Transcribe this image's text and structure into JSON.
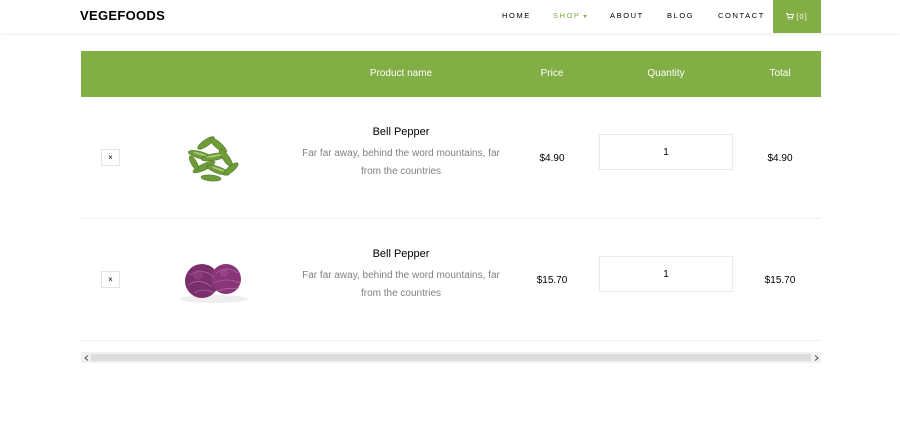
{
  "brand": "VEGEFOODS",
  "nav": {
    "items": [
      "HOME",
      "SHOP",
      "ABOUT",
      "BLOG",
      "CONTACT"
    ],
    "active": "SHOP",
    "cart_label": "[0]",
    "accent": "#82ae46"
  },
  "table": {
    "headers": {
      "product_name": "Product name",
      "price": "Price",
      "quantity": "Quantity",
      "total": "Total"
    },
    "rows": [
      {
        "remove": "×",
        "image": "green-peas",
        "name": "Bell Pepper",
        "description": "Far far away, behind the word mountains, far from the countries",
        "price": "$4.90",
        "quantity": "1",
        "total": "$4.90"
      },
      {
        "remove": "×",
        "image": "red-cabbage",
        "name": "Bell Pepper",
        "description": "Far far away, behind the word mountains, far from the countries",
        "price": "$15.70",
        "quantity": "1",
        "total": "$15.70"
      }
    ]
  },
  "icons": {
    "cart": "cart-icon",
    "caret": "chevron-down-icon",
    "scroll_left": "chevron-left-icon",
    "scroll_right": "chevron-right-icon"
  }
}
